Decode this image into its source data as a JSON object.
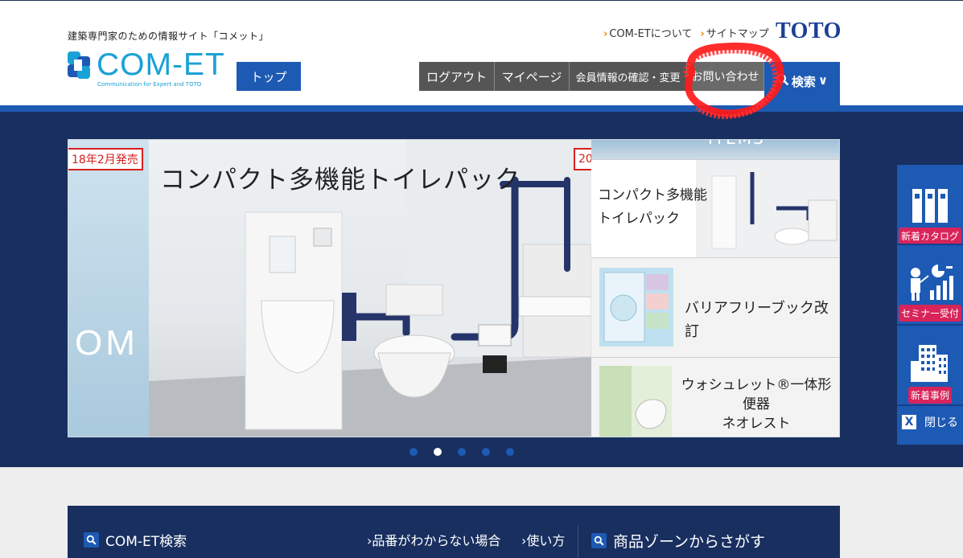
{
  "header": {
    "tagline": "建築専門家のための情報サイト「コメット」",
    "logo_text": "COM-ET",
    "logo_sub": "Communication for Expert and TOTO",
    "top_button": "トップ",
    "util_links": [
      {
        "arrow": "›",
        "label": "COM-ETについて"
      },
      {
        "arrow": "›",
        "label": "サイトマップ"
      }
    ],
    "brand": "TOTO",
    "nav": [
      {
        "label": "ログアウト"
      },
      {
        "label": "マイページ"
      },
      {
        "label": "会員情報の確認・変更"
      },
      {
        "label": "お問い合わせ"
      }
    ],
    "search_label": "検索",
    "search_chevron": "∨"
  },
  "hero": {
    "badge_left": "18年2月発売",
    "badge_right": "20",
    "slide_title": "コンパクト多機能トイレパック",
    "left_strip_text": "OM",
    "thumb_header": "ITEMS",
    "thumbs": [
      {
        "line1": "コンパクト多機能",
        "line2": "トイレパック"
      },
      {
        "line1": "バリアフリーブック改訂"
      },
      {
        "line1": "ウォシュレット®一体形便器",
        "line2": "ネオレスト"
      }
    ],
    "dots": [
      {
        "active": false
      },
      {
        "active": true
      },
      {
        "active": false
      },
      {
        "active": false
      },
      {
        "active": false
      }
    ]
  },
  "side": {
    "items": [
      {
        "label": "新着カタログ",
        "icon": "catalog-icon"
      },
      {
        "label": "セミナー受付",
        "icon": "seminar-icon"
      },
      {
        "label": "新着事例",
        "icon": "building-icon"
      }
    ],
    "close_x": "X",
    "close_label": "閉じる"
  },
  "search_panel": {
    "title": "COM-ET検索",
    "link1": "›品番がわからない場合",
    "link2": "›使い方",
    "zone_title": "商品ゾーンからさがす"
  },
  "colors": {
    "brand_blue": "#1d5ab4",
    "navy": "#182f5f",
    "accent_pink": "#d8245a",
    "badge_red": "#d62020"
  }
}
